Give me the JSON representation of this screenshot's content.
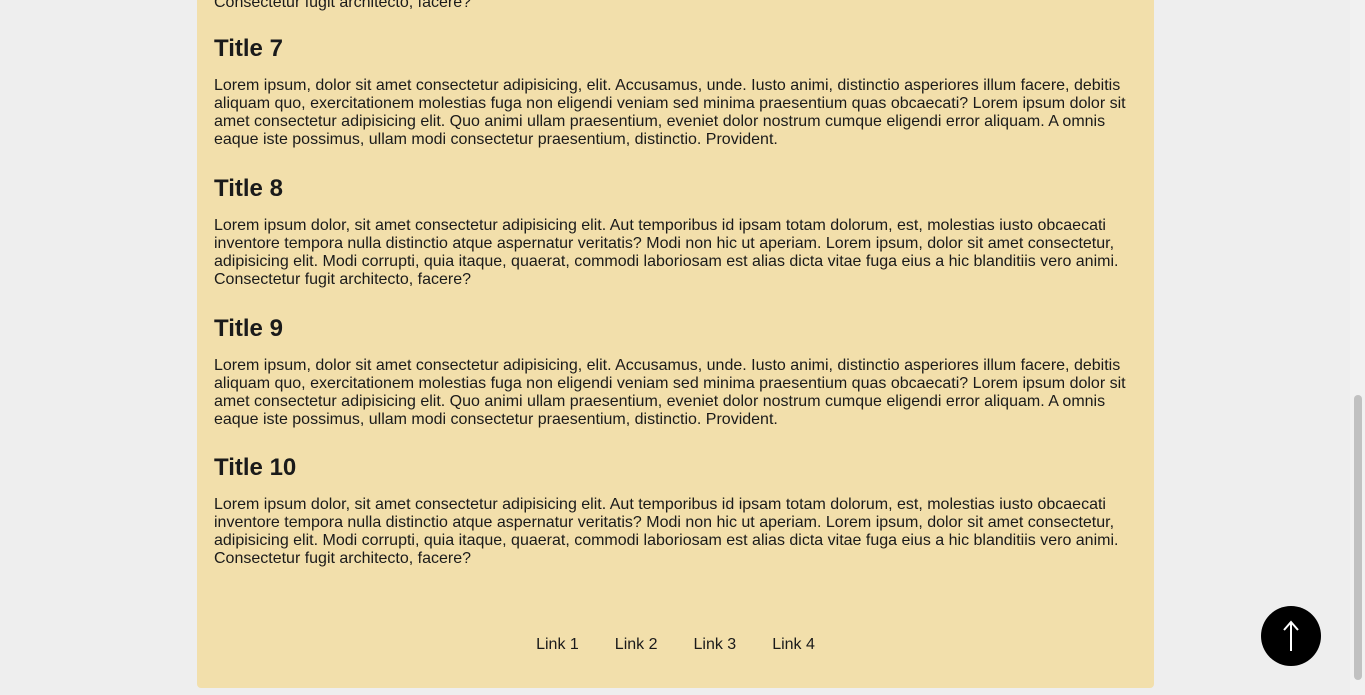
{
  "partial_text": "Consectetur fugit architecto, facere?",
  "sections": [
    {
      "title": "Title 7",
      "body": "Lorem ipsum, dolor sit amet consectetur adipisicing, elit. Accusamus, unde. Iusto animi, distinctio asperiores illum facere, debitis aliquam quo, exercitationem molestias fuga non eligendi veniam sed minima praesentium quas obcaecati? Lorem ipsum dolor sit amet consectetur adipisicing elit. Quo animi ullam praesentium, eveniet dolor nostrum cumque eligendi error aliquam. A omnis eaque iste possimus, ullam modi consectetur praesentium, distinctio. Provident."
    },
    {
      "title": "Title 8",
      "body": "Lorem ipsum dolor, sit amet consectetur adipisicing elit. Aut temporibus id ipsam totam dolorum, est, molestias iusto obcaecati inventore tempora nulla distinctio atque aspernatur veritatis? Modi non hic ut aperiam. Lorem ipsum, dolor sit amet consectetur, adipisicing elit. Modi corrupti, quia itaque, quaerat, commodi laboriosam est alias dicta vitae fuga eius a hic blanditiis vero animi. Consectetur fugit architecto, facere?"
    },
    {
      "title": "Title 9",
      "body": "Lorem ipsum, dolor sit amet consectetur adipisicing, elit. Accusamus, unde. Iusto animi, distinctio asperiores illum facere, debitis aliquam quo, exercitationem molestias fuga non eligendi veniam sed minima praesentium quas obcaecati? Lorem ipsum dolor sit amet consectetur adipisicing elit. Quo animi ullam praesentium, eveniet dolor nostrum cumque eligendi error aliquam. A omnis eaque iste possimus, ullam modi consectetur praesentium, distinctio. Provident."
    },
    {
      "title": "Title 10",
      "body": "Lorem ipsum dolor, sit amet consectetur adipisicing elit. Aut temporibus id ipsam totam dolorum, est, molestias iusto obcaecati inventore tempora nulla distinctio atque aspernatur veritatis? Modi non hic ut aperiam. Lorem ipsum, dolor sit amet consectetur, adipisicing elit. Modi corrupti, quia itaque, quaerat, commodi laboriosam est alias dicta vitae fuga eius a hic blanditiis vero animi. Consectetur fugit architecto, facere?"
    }
  ],
  "footer": {
    "links": [
      "Link 1",
      "Link 2",
      "Link 3",
      "Link 4"
    ]
  },
  "back_to_top": {
    "icon": "arrow-up-icon"
  },
  "colors": {
    "page_background": "#eeeeee",
    "card_background": "#f2dfab",
    "text": "#1a1a1a",
    "button": "#000000"
  }
}
